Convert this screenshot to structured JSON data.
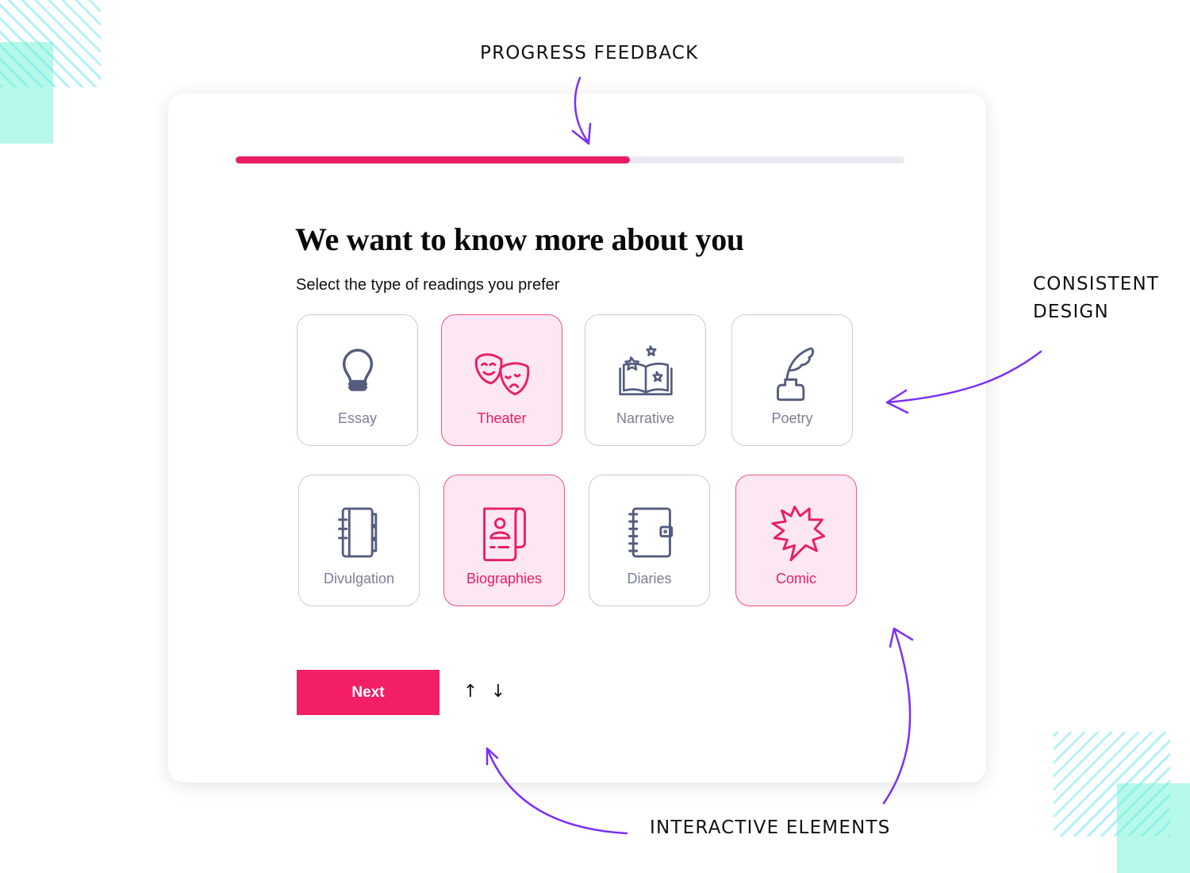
{
  "annotations": {
    "progress_feedback": "PROGRESS FEEDBACK",
    "consistent_design": "CONSISTENT DESIGN",
    "interactive_elements": "INTERACTIVE ELEMENTS",
    "arrow_color": "#7b2ff7"
  },
  "form": {
    "progress_percent": 59,
    "title": "We want to know more about you",
    "subtitle": "Select the type of readings you prefer",
    "options": [
      {
        "label": "Essay",
        "icon": "lightbulb-icon",
        "selected": false
      },
      {
        "label": "Theater",
        "icon": "theater-masks-icon",
        "selected": true
      },
      {
        "label": "Narrative",
        "icon": "open-book-stars-icon",
        "selected": false
      },
      {
        "label": "Poetry",
        "icon": "quill-inkwell-icon",
        "selected": false
      },
      {
        "label": "Divulgation",
        "icon": "notebook-icon",
        "selected": false
      },
      {
        "label": "Biographies",
        "icon": "biography-scroll-icon",
        "selected": true
      },
      {
        "label": "Diaries",
        "icon": "diary-icon",
        "selected": false
      },
      {
        "label": "Comic",
        "icon": "comic-burst-icon",
        "selected": true
      }
    ],
    "next_label": "Next",
    "up_arrow": "↑",
    "down_arrow": "↓"
  },
  "colors": {
    "accent": "#e91e63",
    "selected_bg": "#fde7f3",
    "icon_default": "#555c7e",
    "track": "#e9eaf2"
  }
}
